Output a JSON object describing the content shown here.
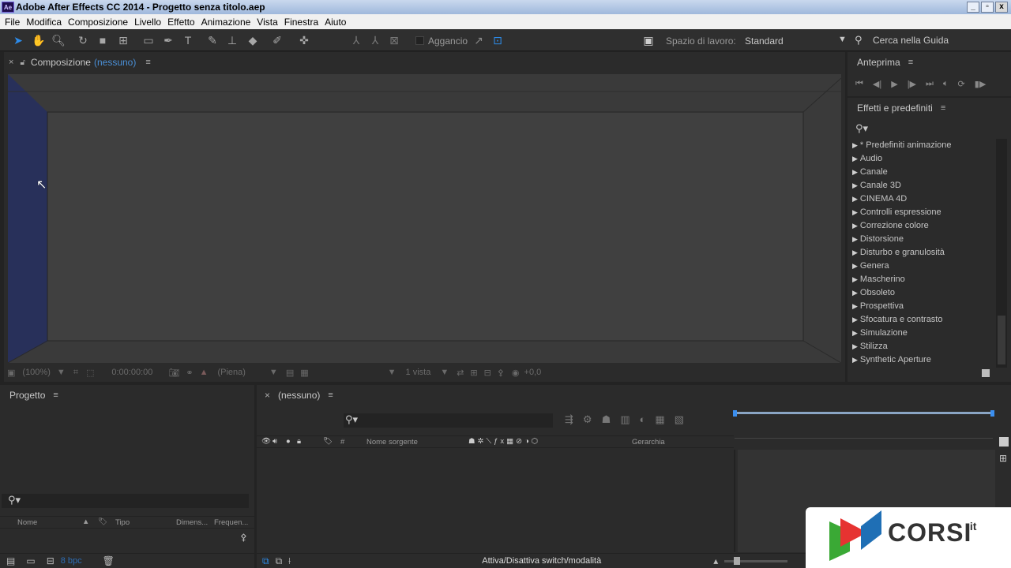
{
  "titlebar": {
    "app_icon": "Ae",
    "title": "Adobe After Effects CC 2014 - Progetto senza titolo.aep",
    "minimize": "_",
    "restore": "▫",
    "close": "x"
  },
  "menu": [
    "File",
    "Modifica",
    "Composizione",
    "Livello",
    "Effetto",
    "Animazione",
    "Vista",
    "Finestra",
    "Aiuto"
  ],
  "toolbar": {
    "tools": [
      "selection-tool-icon",
      "hand-tool-icon",
      "zoom-tool-icon",
      "rotate-tool-icon",
      "camera-tool-icon",
      "pan-behind-tool-icon",
      "rectangle-tool-icon",
      "pen-tool-icon",
      "type-tool-icon",
      "brush-tool-icon",
      "clone-stamp-tool-icon",
      "eraser-tool-icon",
      "roto-brush-tool-icon",
      "puppet-pin-tool-icon"
    ],
    "snap_label": "Aggancio",
    "workspace_label": "Spazio di lavoro:",
    "workspace_value": "Standard",
    "help_placeholder": "Cerca nella Guida"
  },
  "composition": {
    "tab_label": "Composizione",
    "tab_sub": "(nessuno)",
    "footer": {
      "zoom": "(100%)",
      "timecode": "0:00:00:00",
      "resolution": "(Piena)",
      "views": "1 vista",
      "exposure": "+0,0"
    }
  },
  "preview": {
    "title": "Anteprima"
  },
  "effects": {
    "title": "Effetti e predefiniti",
    "items": [
      "* Predefiniti animazione",
      "Audio",
      "Canale",
      "Canale 3D",
      "CINEMA 4D",
      "Controlli espressione",
      "Correzione colore",
      "Distorsione",
      "Disturbo e granulosità",
      "Genera",
      "Mascherino",
      "Obsoleto",
      "Prospettiva",
      "Sfocatura e contrasto",
      "Simulazione",
      "Stilizza",
      "Synthetic Aperture"
    ]
  },
  "project": {
    "title": "Progetto",
    "columns": {
      "name": "Nome",
      "type": "Tipo",
      "dims": "Dimens...",
      "freq": "Frequen..."
    },
    "bpc": "8 bpc"
  },
  "timeline": {
    "tab_label": "(nessuno)",
    "columns": {
      "hash": "#",
      "source": "Nome sorgente",
      "parent": "Gerarchia"
    },
    "footer_toggle": "Attiva/Disattiva switch/modalità"
  },
  "watermark": {
    "brand": "CORSI",
    "suffix": ".it",
    "colors": {
      "red": "#e63331",
      "blue": "#1f6fb5",
      "green": "#3aa935"
    }
  }
}
